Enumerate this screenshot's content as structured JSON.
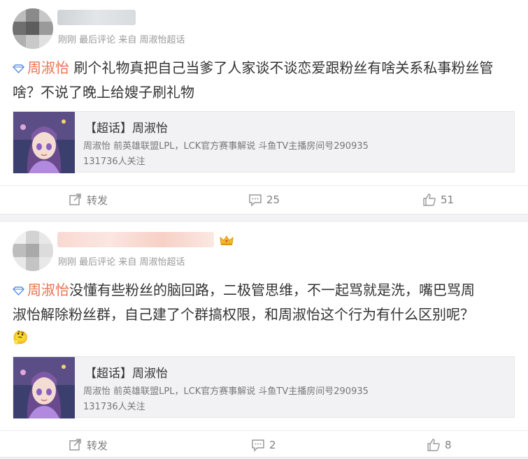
{
  "posts": [
    {
      "meta": {
        "time": "刚刚",
        "source_label": "最后评论",
        "from_label": "来自",
        "source": "周淑怡超话"
      },
      "topic_tag": "周淑怡",
      "text": "刷个礼物真把自己当爹了人家谈不谈恋爱跟粉丝有啥关系私事粉丝管啥？不说了晚上给嫂子刷礼物",
      "card": {
        "title": "【超话】周淑怡",
        "desc": "周淑怡 前英雄联盟LPL，LCK官方赛事解说 斗鱼TV主播房间号290935",
        "followers": "131736人关注"
      },
      "actions": {
        "repost": "转发",
        "comments": "25",
        "likes": "51"
      }
    },
    {
      "meta": {
        "time": "刚刚",
        "source_label": "最后评论",
        "from_label": "来自",
        "source": "周淑怡超话"
      },
      "topic_tag": "周淑怡",
      "text_line1": "没懂有些粉丝的脑回路，二极管思维，不一起骂就是洗，嘴巴骂周",
      "text_line2": "淑怡解除粉丝群，自己建了个群搞权限，和周淑怡这个行为有什么区别呢？",
      "emoji": "🤔",
      "card": {
        "title": "【超话】周淑怡",
        "desc": "周淑怡 前英雄联盟LPL，LCK官方赛事解说 斗鱼TV主播房间号290935",
        "followers": "131736人关注"
      },
      "actions": {
        "repost": "转发",
        "comments": "2",
        "likes": "8"
      }
    }
  ],
  "icons": {
    "topic": "diamond-icon",
    "repost": "repost-icon",
    "comment": "comment-icon",
    "like": "thumbs-up-icon",
    "badge": "crown-badge-icon"
  },
  "colors": {
    "tag": "#eb7350",
    "meta": "#999999",
    "action": "#808080",
    "diamond": "#5d8fe6"
  }
}
